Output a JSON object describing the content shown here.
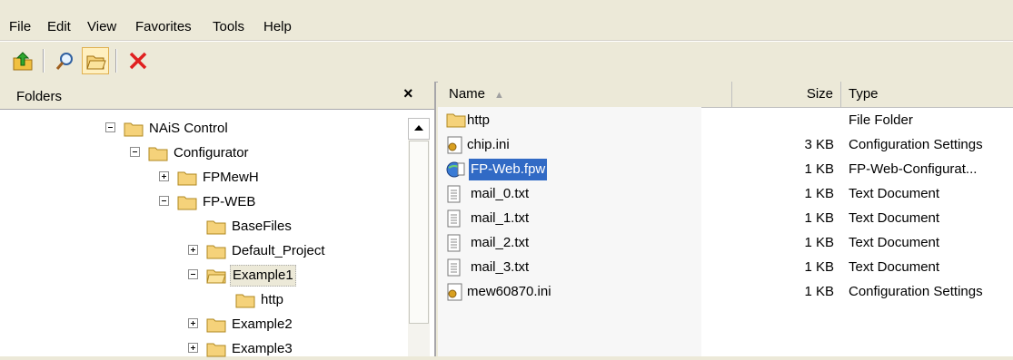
{
  "menu": [
    "File",
    "Edit",
    "View",
    "Favorites",
    "Tools",
    "Help"
  ],
  "toolbar": {
    "buttons": [
      "up-folder-icon",
      "search-icon",
      "folders-icon",
      "delete-icon"
    ]
  },
  "folders_pane": {
    "title": "Folders",
    "close": "×",
    "tree": [
      {
        "label": "NAiS Control",
        "expander": "minus"
      },
      {
        "label": "Configurator",
        "expander": "minus"
      },
      {
        "label": "FPMewH",
        "expander": "plus"
      },
      {
        "label": "FP-WEB",
        "expander": "minus"
      },
      {
        "label": "BaseFiles",
        "expander": ""
      },
      {
        "label": "Default_Project",
        "expander": "plus"
      },
      {
        "label": "Example1",
        "expander": "minus"
      },
      {
        "label": "http",
        "expander": ""
      },
      {
        "label": "Example2",
        "expander": "plus"
      },
      {
        "label": "Example3",
        "expander": "plus"
      }
    ]
  },
  "file_list": {
    "columns": {
      "name": "Name",
      "size": "Size",
      "type": "Type"
    },
    "sort_indicator": "▲",
    "rows": [
      {
        "name": "http",
        "size": "",
        "type": "File Folder",
        "icon": "folder-icon"
      },
      {
        "name": "chip.ini",
        "size": "3 KB",
        "type": "Configuration Settings",
        "icon": "config-file-icon"
      },
      {
        "name": "FP-Web.fpw",
        "size": "1 KB",
        "type": "FP-Web-Configurat...",
        "icon": "fpw-file-icon"
      },
      {
        "name": "mail_0.txt",
        "size": "1 KB",
        "type": "Text Document",
        "icon": "text-file-icon"
      },
      {
        "name": "mail_1.txt",
        "size": "1 KB",
        "type": "Text Document",
        "icon": "text-file-icon"
      },
      {
        "name": "mail_2.txt",
        "size": "1 KB",
        "type": "Text Document",
        "icon": "text-file-icon"
      },
      {
        "name": "mail_3.txt",
        "size": "1 KB",
        "type": "Text Document",
        "icon": "text-file-icon"
      },
      {
        "name": "mew60870.ini",
        "size": "1 KB",
        "type": "Configuration Settings",
        "icon": "config-file-icon"
      }
    ]
  },
  "colors": {
    "selection": "#316ac5",
    "folder": "#f5d27a",
    "chrome": "#ece9d8"
  }
}
